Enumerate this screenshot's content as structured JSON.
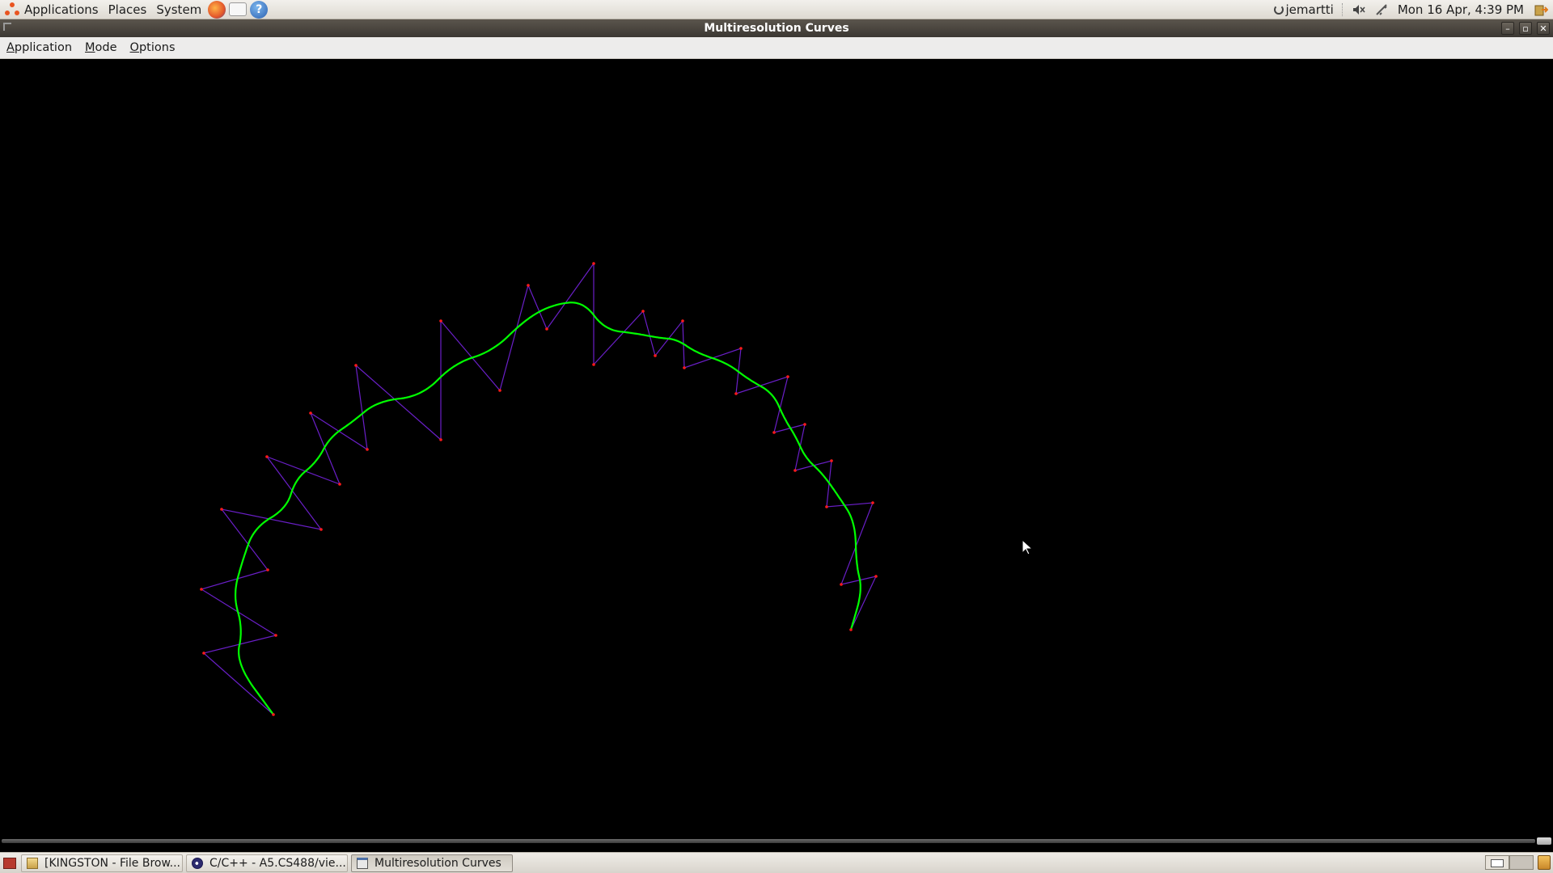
{
  "top_panel": {
    "menus": [
      "Applications",
      "Places",
      "System"
    ],
    "launchers": [
      "firefox-icon",
      "mail-icon",
      "help-icon"
    ],
    "user": "jemartti",
    "datetime": "Mon 16 Apr,  4:39 PM"
  },
  "window": {
    "title": "Multiresolution Curves",
    "menu": [
      "Application",
      "Mode",
      "Options"
    ]
  },
  "colors": {
    "curve": "#00ff00",
    "control_polygon": "#6a1fc8",
    "control_points": "#ff1a1a",
    "canvas_bg": "#000000"
  },
  "taskbar": {
    "tasks": [
      {
        "label": "[KINGSTON - File Brow...",
        "icon": "folder-icon",
        "active": false
      },
      {
        "label": "C/C++ - A5.CS488/vie...",
        "icon": "eclipse-icon",
        "active": false
      },
      {
        "label": "Multiresolution Curves",
        "icon": "window-icon",
        "active": true
      }
    ]
  }
}
